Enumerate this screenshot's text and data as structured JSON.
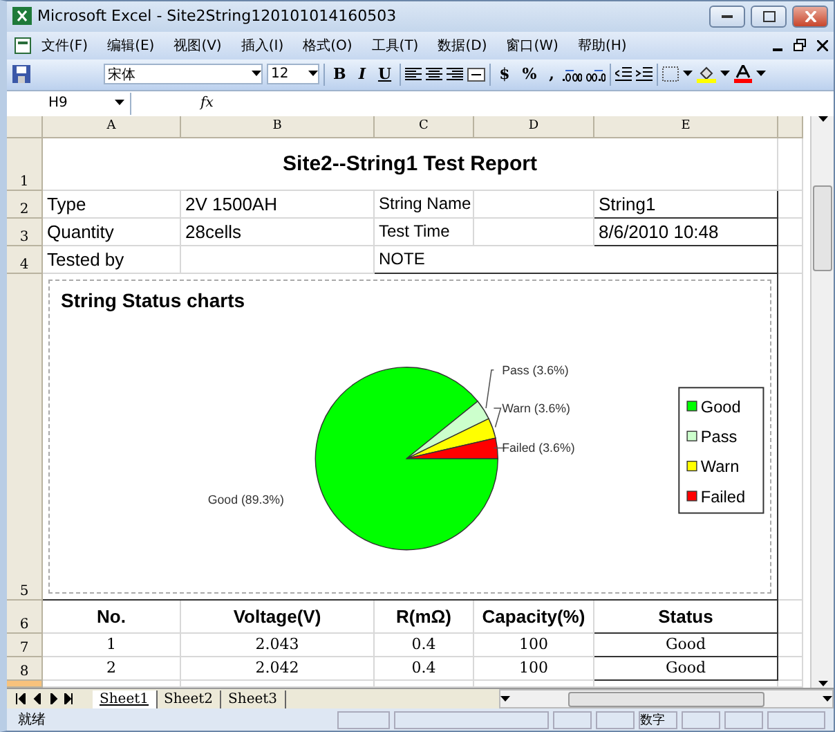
{
  "window": {
    "title": "Microsoft Excel - Site2String120101014160503"
  },
  "menu": [
    "文件(F)",
    "编辑(E)",
    "视图(V)",
    "插入(I)",
    "格式(O)",
    "工具(T)",
    "数据(D)",
    "窗口(W)",
    "帮助(H)"
  ],
  "toolbar": {
    "font": "宋体",
    "size": "12",
    "style_buttons": [
      "B",
      "I",
      "U"
    ],
    "number_buttons": [
      "$",
      "%",
      ","
    ]
  },
  "formula_bar": {
    "name_box": "H9",
    "fx": "fx"
  },
  "sheet": {
    "columns": [
      "A",
      "B",
      "C",
      "D",
      "E"
    ],
    "row_numbers": [
      "1",
      "2",
      "3",
      "4",
      "5",
      "6",
      "7",
      "8"
    ],
    "title": "Site2--String1 Test Report",
    "info": [
      {
        "label": "Type",
        "value": "2V 1500AH",
        "label2": "String Name",
        "value2": "String1"
      },
      {
        "label": "Quantity",
        "value": "28cells",
        "label2": "Test Time",
        "value2": "8/6/2010 10:48"
      },
      {
        "label": "Tested by",
        "label2": "NOTE"
      }
    ],
    "chart": {
      "title": "String Status charts",
      "chart_data": {
        "type": "pie",
        "categories": [
          "Good",
          "Pass",
          "Warn",
          "Failed"
        ],
        "series": [
          {
            "values": [
              89.3,
              3.6,
              3.6,
              3.6
            ]
          }
        ],
        "value_labels": [
          "Good (89.3%)",
          "Pass (3.6%)",
          "Warn (3.6%)",
          "Failed (3.6%)"
        ],
        "legend": true
      },
      "slices": [
        {
          "color": "#00ff00"
        },
        {
          "color": "#ccffcc"
        },
        {
          "color": "#ffff00"
        },
        {
          "color": "#ff0000"
        }
      ]
    },
    "table": {
      "columns": [
        "No.",
        "Voltage(V)",
        "R(mΩ)",
        "Capacity(%)",
        "Status"
      ],
      "rows": [
        [
          "1",
          "2.043",
          "0.4",
          "100",
          "Good"
        ],
        [
          "2",
          "2.042",
          "0.4",
          "100",
          "Good"
        ]
      ]
    }
  },
  "sheet_tabs": [
    {
      "label": "Sheet1",
      "selected": true
    },
    {
      "label": "Sheet2",
      "selected": false
    },
    {
      "label": "Sheet3",
      "selected": false
    }
  ],
  "status_bar": {
    "state": "就绪",
    "mode": "数字"
  }
}
